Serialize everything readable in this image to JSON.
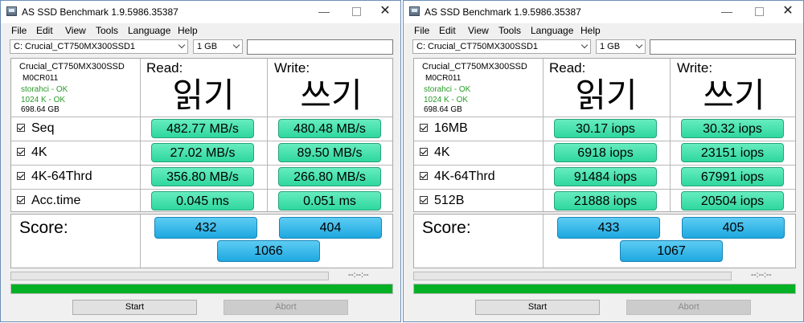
{
  "windows": [
    {
      "title": "AS SSD Benchmark 1.9.5986.35387",
      "menu": [
        "File",
        "Edit",
        "View",
        "Tools",
        "Language",
        "Help"
      ],
      "drive_select": "C: Crucial_CT750MX300SSD1",
      "size_select": "1 GB",
      "drive": {
        "name": "Crucial_CT750MX300SSD",
        "firmware": "M0CR011",
        "status_1": "storahci - OK",
        "status_2": "1024 K - OK",
        "capacity": "698.64 GB"
      },
      "read_header": "Read:",
      "write_header": "Write:",
      "read_big": "읽기",
      "write_big": "쓰기",
      "rows": [
        {
          "label": "Seq",
          "read": "482.77 MB/s",
          "write": "480.48 MB/s"
        },
        {
          "label": "4K",
          "read": "27.02 MB/s",
          "write": "89.50 MB/s"
        },
        {
          "label": "4K-64Thrd",
          "read": "356.80 MB/s",
          "write": "266.80 MB/s"
        },
        {
          "label": "Acc.time",
          "read": "0.045 ms",
          "write": "0.051 ms"
        }
      ],
      "score_label": "Score:",
      "score_read": "432",
      "score_write": "404",
      "score_total": "1066",
      "time": "--:--:--",
      "progress": 1.0,
      "start_label": "Start",
      "abort_label": "Abort"
    },
    {
      "title": "AS SSD Benchmark 1.9.5986.35387",
      "menu": [
        "File",
        "Edit",
        "View",
        "Tools",
        "Language",
        "Help"
      ],
      "drive_select": "C: Crucial_CT750MX300SSD1",
      "size_select": "1 GB",
      "drive": {
        "name": "Crucial_CT750MX300SSD",
        "firmware": "M0CR011",
        "status_1": "storahci - OK",
        "status_2": "1024 K - OK",
        "capacity": "698.64 GB"
      },
      "read_header": "Read:",
      "write_header": "Write:",
      "read_big": "읽기",
      "write_big": "쓰기",
      "rows": [
        {
          "label": "16MB",
          "read": "30.17 iops",
          "write": "30.32 iops"
        },
        {
          "label": "4K",
          "read": "6918 iops",
          "write": "23151 iops"
        },
        {
          "label": "4K-64Thrd",
          "read": "91484 iops",
          "write": "67991 iops"
        },
        {
          "label": "512B",
          "read": "21888 iops",
          "write": "20504 iops"
        }
      ],
      "score_label": "Score:",
      "score_read": "433",
      "score_write": "405",
      "score_total": "1067",
      "time": "--:--:--",
      "progress": 1.0,
      "start_label": "Start",
      "abort_label": "Abort"
    }
  ],
  "colors": {
    "result_pill": "#3ddfa8",
    "score_pill": "#2cb6e8",
    "progress_fill": "#06b025",
    "status_ok": "#2a9a2a"
  },
  "icons": {
    "app": "benchmark-app-icon",
    "checkbox": "checkbox-checked-icon",
    "dropdown": "chevron-down-icon"
  }
}
